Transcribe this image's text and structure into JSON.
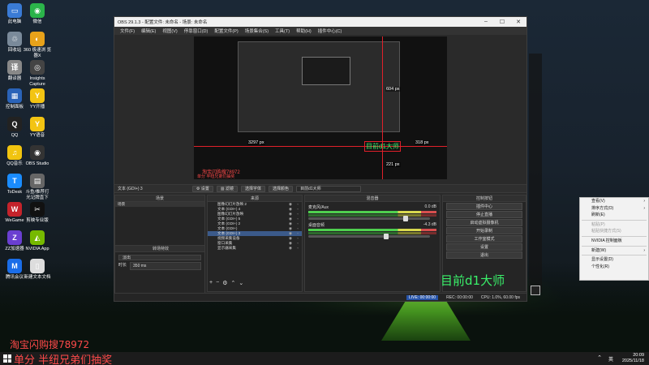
{
  "desktop": {
    "icons": [
      {
        "label": "此电脑",
        "glyph": "▭",
        "color": "#3a7bd5"
      },
      {
        "label": "微信",
        "glyph": "◉",
        "color": "#2bb44a"
      },
      {
        "label": "回收站",
        "glyph": "♲",
        "color": "#7a8a9a"
      },
      {
        "label": "360 极速浏\n览器X",
        "glyph": "◐",
        "color": "#e8a21a"
      },
      {
        "label": "翻译器",
        "glyph": "译",
        "color": "#888"
      },
      {
        "label": "Insights\nCapture",
        "glyph": "◎",
        "color": "#444"
      },
      {
        "label": "控制面板",
        "glyph": "▦",
        "color": "#2a63b8"
      },
      {
        "label": "YY开播",
        "glyph": "Y",
        "color": "#f3c413"
      },
      {
        "label": "QQ",
        "glyph": "Q",
        "color": "#222"
      },
      {
        "label": "YY语音",
        "glyph": "Y",
        "color": "#f3c413"
      },
      {
        "label": "QQ音乐",
        "glyph": "♫",
        "color": "#f1c40f"
      },
      {
        "label": "OBS Studio",
        "glyph": "◉",
        "color": "#333"
      },
      {
        "label": "ToDesk",
        "glyph": "T",
        "color": "#1a8cff"
      },
      {
        "label": "斗鱼/推荐打\n光记牌直下",
        "glyph": "▤",
        "color": "#666"
      },
      {
        "label": "WeGame",
        "glyph": "W",
        "color": "#c4232b"
      },
      {
        "label": "剪映专业版",
        "glyph": "✂",
        "color": "#111"
      },
      {
        "label": "ZZ加速器",
        "glyph": "Z",
        "color": "#6a3fd1"
      },
      {
        "label": "NVIDIA App",
        "glyph": "◭",
        "color": "#76b900"
      },
      {
        "label": "腾讯会议",
        "glyph": "M",
        "color": "#1a6de8"
      },
      {
        "label": "新建文本文档",
        "glyph": "▯",
        "color": "#ddd"
      }
    ],
    "promo_bottom_line1": "淘宝闪购搜78972",
    "promo_bottom_line2": "单分  半纽兄弟们抽奖",
    "clock_time": "20:09",
    "clock_date": "2025/11/18",
    "ime": "英"
  },
  "obs": {
    "title": "OBS 29.1.3 - 配置文件: 未命名 - 场景: 未命名",
    "menu": [
      "文件(F)",
      "编辑(E)",
      "视图(V)",
      "停靠窗口(D)",
      "配置文件(P)",
      "场景集合(S)",
      "工具(T)",
      "帮助(H)",
      "插件中心(C)"
    ],
    "preview_labels": {
      "left_px": "3297 px",
      "top_px": "604 px",
      "bottom_px": "221 px",
      "right_px": "318 px",
      "overlay_text": "目前d1大师",
      "inner_promo": "淘宝闪购搜78972",
      "inner_promo2": "单分 半纽兄弟们抽奖"
    },
    "source_bar": {
      "selected": "文本 (GDI+) 3",
      "props": "设置",
      "filters": "滤镜",
      "pick_font": "选择字体",
      "pick_color": "选择颜色",
      "text_value": "目前d1大师"
    },
    "scenes": {
      "title": "场景",
      "items": [
        "场景"
      ]
    },
    "sources": {
      "title": "来源",
      "items": [
        "图像幻灯片放映 2",
        "文本 (GDI+) 4",
        "图像幻灯片放映",
        "文本 (GDI+) 5",
        "文本 (GDI+) 2",
        "文本 (GDI+)",
        "文本 (GDI+) 3",
        "视频采集设备",
        "窗口采集",
        "显示器采集"
      ],
      "selected_index": 6
    },
    "transitions": {
      "title": "转场特效",
      "type": "淡出",
      "duration_label": "时长",
      "duration_value": "350 ms"
    },
    "mixer": {
      "title": "混音器",
      "channels": [
        {
          "name": "麦克风/Aux",
          "db": "0.0 dB",
          "level": 0.78
        },
        {
          "name": "桌面音频",
          "db": "-4.3 dB",
          "level": 0.62
        }
      ]
    },
    "controls": {
      "title": "控制按钮",
      "buttons": [
        "插件中心",
        "停止直播",
        "启动虚拟摄像机",
        "开始录制",
        "工作室模式",
        "设置",
        "退出"
      ]
    },
    "status": {
      "live": "LIVE: 00:00:00",
      "rec": "REC: 00:00:00",
      "cpu": "CPU: 1.0%, 60.00 fps"
    },
    "big_overlay": "目前d1大师"
  },
  "context_menu": {
    "items": [
      {
        "label": "查看(V)",
        "arrow": true,
        "dim": false
      },
      {
        "label": "排序方式(O)",
        "arrow": true,
        "dim": false
      },
      {
        "label": "刷新(E)",
        "arrow": false,
        "dim": false
      },
      {
        "label": "粘贴(P)",
        "arrow": false,
        "dim": true
      },
      {
        "label": "粘贴快捷方式(S)",
        "arrow": false,
        "dim": true
      },
      {
        "label": "NVIDIA 控制面板",
        "arrow": false,
        "dim": false
      },
      {
        "label": "新建(W)",
        "arrow": true,
        "dim": false
      },
      {
        "label": "显示设置(D)",
        "arrow": false,
        "dim": false
      },
      {
        "label": "个性化(R)",
        "arrow": false,
        "dim": false
      }
    ]
  }
}
